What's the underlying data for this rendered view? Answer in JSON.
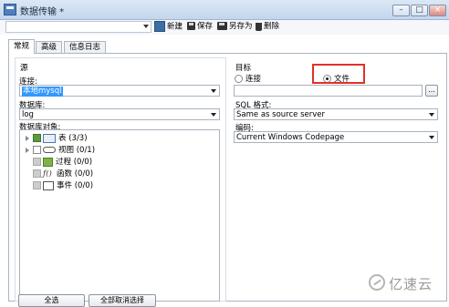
{
  "window": {
    "title": "数据传输 *",
    "controls": {
      "minimize": "–",
      "maximize": "□",
      "close": "×"
    }
  },
  "toolbar": {
    "new_label": "新建",
    "save_label": "保存",
    "saveas_label": "另存为",
    "delete_label": "删除"
  },
  "tabs": [
    {
      "label": "常规",
      "selected": true
    },
    {
      "label": "高级"
    },
    {
      "label": "信息日志"
    }
  ],
  "source": {
    "group_label": "源",
    "connection_label": "连接:",
    "connection_value": "本地mysql",
    "database_label": "数据库:",
    "database_value": "log",
    "objects_label": "数据库对象:",
    "tree": [
      {
        "label": "表",
        "count": "(3/3)",
        "icon": "table-icon"
      },
      {
        "label": "视图",
        "count": "(0/1)",
        "icon": "view-icon"
      },
      {
        "label": "过程",
        "count": "(0/0)",
        "icon": "procedure-icon"
      },
      {
        "label": "函数",
        "count": "(0/0)",
        "icon": "function-icon"
      },
      {
        "label": "事件",
        "count": "(0/0)",
        "icon": "event-icon"
      }
    ],
    "select_all_label": "全选",
    "deselect_all_label": "全部取消选择"
  },
  "target": {
    "group_label": "目标",
    "option_connection": "连接",
    "option_file": "文件",
    "selected_option": "文件",
    "sql_format_label": "SQL 格式:",
    "sql_format_value": "Same as source server",
    "encoding_label": "编码:",
    "encoding_value": "Current Windows Codepage",
    "browse_label": "..."
  },
  "watermark": {
    "text": "亿速云"
  },
  "colors": {
    "highlight": "#e2302a",
    "selection": "#3399ff"
  }
}
